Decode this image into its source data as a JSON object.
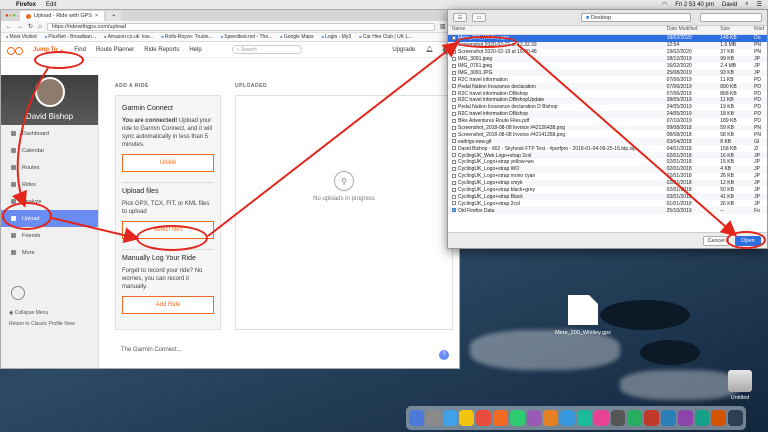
{
  "menubar": {
    "app": "Firefox",
    "items": [
      "Edit"
    ],
    "clock": "Fri 2 53 40 pm",
    "user": "David"
  },
  "browser": {
    "tabs": [
      {
        "label": "Upload - Ride with GPS"
      },
      {
        "label": "+"
      }
    ],
    "url": "https://ridewithgps.com/upload",
    "bookmarks": [
      "Most Visited",
      "PlusNet - Broadban...",
      "Amazon.co.uk: low...",
      "Rolls-Royce: Truste...",
      "Speedtest.net - The...",
      "Google Maps",
      "Login - My3",
      "Car Hire Club | UK L..."
    ],
    "nav": {
      "jump_to": "Jump To",
      "find": "Find",
      "route_planner": "Route Planner",
      "ride_reports": "Ride Reports",
      "help": "Help",
      "search_placeholder": "Search",
      "upgrade": "Upgrade"
    }
  },
  "sidebar": {
    "profile_name": "David Bishop",
    "items": [
      {
        "label": "Dashboard"
      },
      {
        "label": "Calendar"
      },
      {
        "label": "Routes"
      },
      {
        "label": "Rides"
      },
      {
        "label": "Analyze"
      },
      {
        "label": "Upload"
      },
      {
        "label": "Friends"
      },
      {
        "label": "More"
      }
    ],
    "collapse": "Collapse Menu",
    "classic": "Return to Classic Profile View"
  },
  "main": {
    "add_ride_title": "ADD A RIDE",
    "uploaded_title": "UPLOADED",
    "garmin": {
      "title": "Garmin Connect",
      "connected_bold": "You are connected!",
      "connected_text": "Upload your ride to Garmin Connect, and it will sync automatically in less than 5 minutes.",
      "unlink": "Unlink"
    },
    "upload_files": {
      "title": "Upload files",
      "text": "Pick GPX, TCX, FIT, or KML files to upload",
      "button": "Select files"
    },
    "manual": {
      "title": "Manually Log Your Ride",
      "text": "Forget to record your ride? No worries, you can record it manually.",
      "button": "Add Ride"
    },
    "footer_partial": "The Garmin Connect...",
    "empty_state": "No uploads in progress",
    "help_icon": "?"
  },
  "dialog": {
    "location": "Desktop",
    "columns": {
      "name": "Name",
      "date": "Date Modified",
      "size": "Size",
      "kind": "Kind"
    },
    "files": [
      {
        "name": "Mere_200_Whitley.gpx",
        "date": "18/02/2020",
        "size": "148 KB",
        "kind": "Do",
        "selected": true
      },
      {
        "name": "Screenshot 2020-02-21 at 12.32.33",
        "date": "12:54",
        "size": "1.6 MB",
        "kind": "PN"
      },
      {
        "name": "Screenshot 2020-02-19 at 16.00.48",
        "date": "19/02/2020",
        "size": "37 KB",
        "kind": "PN"
      },
      {
        "name": "IMG_3091.jpeg",
        "date": "18/12/2019",
        "size": "99 KB",
        "kind": "JP"
      },
      {
        "name": "IMG_0761.jpeg",
        "date": "16/02/2020",
        "size": "2.4 MB",
        "kind": "JP"
      },
      {
        "name": "IMG_3091.JPG",
        "date": "25/08/2019",
        "size": "93 KB",
        "kind": "JP"
      },
      {
        "name": "R2C travel information",
        "date": "07/06/2019",
        "size": "11 KB",
        "kind": "PD"
      },
      {
        "name": "Pedal Nation Insurance declaration",
        "date": "07/06/2019",
        "size": "890 KB",
        "kind": "PD"
      },
      {
        "name": "R2C travel information DBishop",
        "date": "07/06/2019",
        "size": "868 KB",
        "kind": "PD"
      },
      {
        "name": "R2C travel information DBishopUpdate",
        "date": "28/05/2019",
        "size": "11 KB",
        "kind": "PD"
      },
      {
        "name": "Pedal Nation Insurance declaration D Bishop",
        "date": "24/05/2019",
        "size": "19 KB",
        "kind": "PD"
      },
      {
        "name": "R2C travel information DBishop",
        "date": "24/05/2019",
        "size": "18 KB",
        "kind": "PD"
      },
      {
        "name": "Bike Adventures Route Files.pdf",
        "date": "07/10/2019",
        "size": "189 KB",
        "kind": "PD"
      },
      {
        "name": "Screenshot_2018-08-08 Invoice #42126438.png",
        "date": "09/08/2018",
        "size": "59 KB",
        "kind": "PN"
      },
      {
        "name": "Screenshot_2018-08-08 Invoice #42141358.png",
        "date": "08/08/2018",
        "size": "58 KB",
        "kind": "PN"
      },
      {
        "name": "ealtrigs-new.gif",
        "date": "03/04/2018",
        "size": "8 KB",
        "kind": "GI"
      },
      {
        "name": "David Bishop - 902 - Skyhook FTP Test - #perfpro - 2018-01-04-09-25-16.tdp.zip",
        "date": "04/01/2018",
        "size": "158 KB",
        "kind": "ZI"
      },
      {
        "name": "CyclingUK_Web Logo+strap 2col",
        "date": "02/01/2018",
        "size": "16 KB",
        "kind": "JP"
      },
      {
        "name": "CyclingUK_Logo+strap yellow+wo",
        "date": "02/01/2018",
        "size": "15 KB",
        "kind": "JP"
      },
      {
        "name": "CyclingUK_Logo+strap WO",
        "date": "02/01/2018",
        "size": "4 KB",
        "kind": "JP"
      },
      {
        "name": "CyclingUK_Logo+strap mono cyan",
        "date": "02/01/2018",
        "size": "26 KB",
        "kind": "JP"
      },
      {
        "name": "CyclingUK_Logo+strap cmyk",
        "date": "02/01/2018",
        "size": "12 KB",
        "kind": "JP"
      },
      {
        "name": "CyclingUK_Logo+strap black+grey",
        "date": "02/01/2018",
        "size": "50 KB",
        "kind": "JP"
      },
      {
        "name": "CyclingUK_Logo+strap Black",
        "date": "03/01/2018",
        "size": "41 KB",
        "kind": "JP"
      },
      {
        "name": "CyclingUK_Logo+strap 2col",
        "date": "01/01/2018",
        "size": "26 KB",
        "kind": "JP"
      },
      {
        "name": "Old Firefox Data",
        "date": "25/10/2019",
        "size": "--",
        "kind": "Fo",
        "folder": true
      }
    ],
    "cancel": "Cancel",
    "open": "Open"
  },
  "desktop": {
    "file_label": "Mere_200_Whitley.gpx",
    "disk_label": "Untitled"
  },
  "colors": {
    "brand_orange": "#f26a21",
    "selection_blue": "#2f6ee0",
    "annotation_red": "#e3251b",
    "nav_active": "#6b8cf2"
  }
}
